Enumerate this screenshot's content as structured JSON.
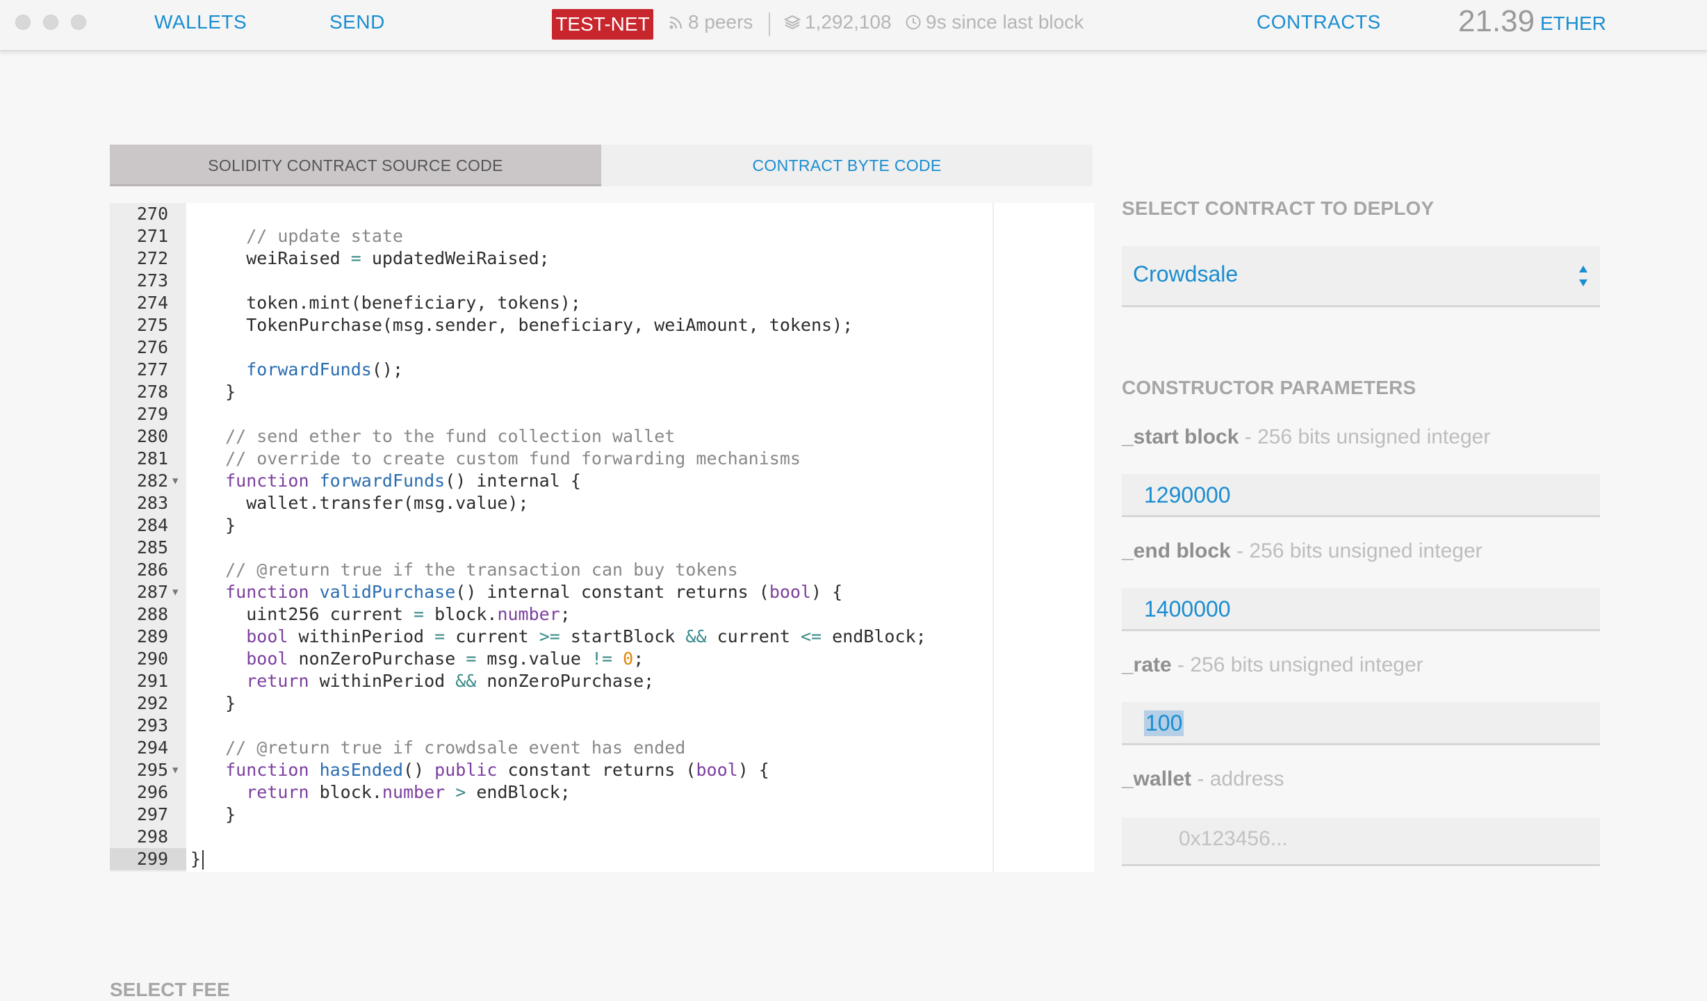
{
  "nav": {
    "wallets": "WALLETS",
    "send": "SEND",
    "network": "TEST-NET",
    "peers": "8 peers",
    "block": "1,292,108",
    "since_last_block": "9s since last block",
    "contracts": "CONTRACTS",
    "balance": "21.39",
    "balance_unit": "ETHER"
  },
  "tabs": {
    "source": "SOLIDITY CONTRACT SOURCE CODE",
    "bytecode": "CONTRACT BYTE CODE"
  },
  "editor": {
    "lines": [
      {
        "n": "270",
        "text": ""
      },
      {
        "n": "271",
        "text": "    // update state"
      },
      {
        "n": "272",
        "text": "    weiRaised = updatedWeiRaised;"
      },
      {
        "n": "273",
        "text": ""
      },
      {
        "n": "274",
        "text": "    token.mint(beneficiary, tokens);"
      },
      {
        "n": "275",
        "text": "    TokenPurchase(msg.sender, beneficiary, weiAmount, tokens);"
      },
      {
        "n": "276",
        "text": ""
      },
      {
        "n": "277",
        "text": "    forwardFunds();"
      },
      {
        "n": "278",
        "text": "  }"
      },
      {
        "n": "279",
        "text": ""
      },
      {
        "n": "280",
        "text": "  // send ether to the fund collection wallet"
      },
      {
        "n": "281",
        "text": "  // override to create custom fund forwarding mechanisms"
      },
      {
        "n": "282",
        "text": "  function forwardFunds() internal {"
      },
      {
        "n": "283",
        "text": "    wallet.transfer(msg.value);"
      },
      {
        "n": "284",
        "text": "  }"
      },
      {
        "n": "285",
        "text": ""
      },
      {
        "n": "286",
        "text": "  // @return true if the transaction can buy tokens"
      },
      {
        "n": "287",
        "text": "  function validPurchase() internal constant returns (bool) {"
      },
      {
        "n": "288",
        "text": "    uint256 current = block.number;"
      },
      {
        "n": "289",
        "text": "    bool withinPeriod = current >= startBlock && current <= endBlock;"
      },
      {
        "n": "290",
        "text": "    bool nonZeroPurchase = msg.value != 0;"
      },
      {
        "n": "291",
        "text": "    return withinPeriod && nonZeroPurchase;"
      },
      {
        "n": "292",
        "text": "  }"
      },
      {
        "n": "293",
        "text": ""
      },
      {
        "n": "294",
        "text": "  // @return true if crowdsale event has ended"
      },
      {
        "n": "295",
        "text": "  function hasEnded() public constant returns (bool) {"
      },
      {
        "n": "296",
        "text": "    return block.number > endBlock;"
      },
      {
        "n": "297",
        "text": "  }"
      },
      {
        "n": "298",
        "text": ""
      },
      {
        "n": "299",
        "text": "}"
      }
    ]
  },
  "deploy": {
    "title": "SELECT CONTRACT TO DEPLOY",
    "selected_contract": "Crowdsale"
  },
  "constructor": {
    "title": "CONSTRUCTOR PARAMETERS",
    "params": [
      {
        "name": "_start block",
        "type": " - 256 bits unsigned integer",
        "value": "1290000",
        "placeholder": ""
      },
      {
        "name": "_end block",
        "type": " - 256 bits unsigned integer",
        "value": "1400000",
        "placeholder": ""
      },
      {
        "name": "_rate",
        "type": " - 256 bits unsigned integer",
        "value": "100",
        "placeholder": ""
      },
      {
        "name": "_wallet",
        "type": " - address",
        "value": "",
        "placeholder": "0x123456..."
      }
    ]
  },
  "fee": {
    "title": "SELECT FEE"
  },
  "colors": {
    "accent": "#1a8dd1",
    "testnet": "#c8262d"
  }
}
